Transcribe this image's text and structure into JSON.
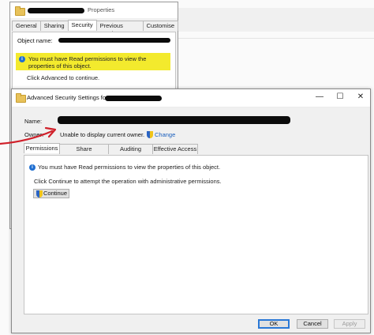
{
  "properties_dialog": {
    "title": "Properties",
    "tabs": [
      "General",
      "Sharing",
      "Security",
      "Previous Versions",
      "Customise"
    ],
    "active_tab": "Security",
    "object_name_label": "Object name:",
    "permission_message": "You must have Read permissions to view the properties of this object.",
    "advanced_text": "Click Advanced to continue."
  },
  "advanced_dialog": {
    "title": "Advanced Security Settings for",
    "name_label": "Name:",
    "owner_label": "Owner:",
    "owner_value": "Unable to display current owner.",
    "change_link": "Change",
    "tabs": [
      "Permissions",
      "Share",
      "Auditing",
      "Effective Access"
    ],
    "active_tab": "Permissions",
    "permission_message": "You must have Read permissions to view the properties of this object.",
    "continue_text": "Click Continue to attempt the operation with administrative permissions.",
    "continue_button": "Continue",
    "buttons": {
      "ok": "OK",
      "cancel": "Cancel",
      "apply": "Apply"
    },
    "controls": {
      "minimize": "—",
      "maximize": "☐",
      "close": "✕"
    }
  },
  "colors": {
    "highlight": "#f3ea2d",
    "link": "#1a5fbd",
    "annotation_arrow": "#d0202a",
    "redaction": "#0b0b0b"
  },
  "icons": [
    "folder-icon",
    "info-icon",
    "shield-icon"
  ]
}
